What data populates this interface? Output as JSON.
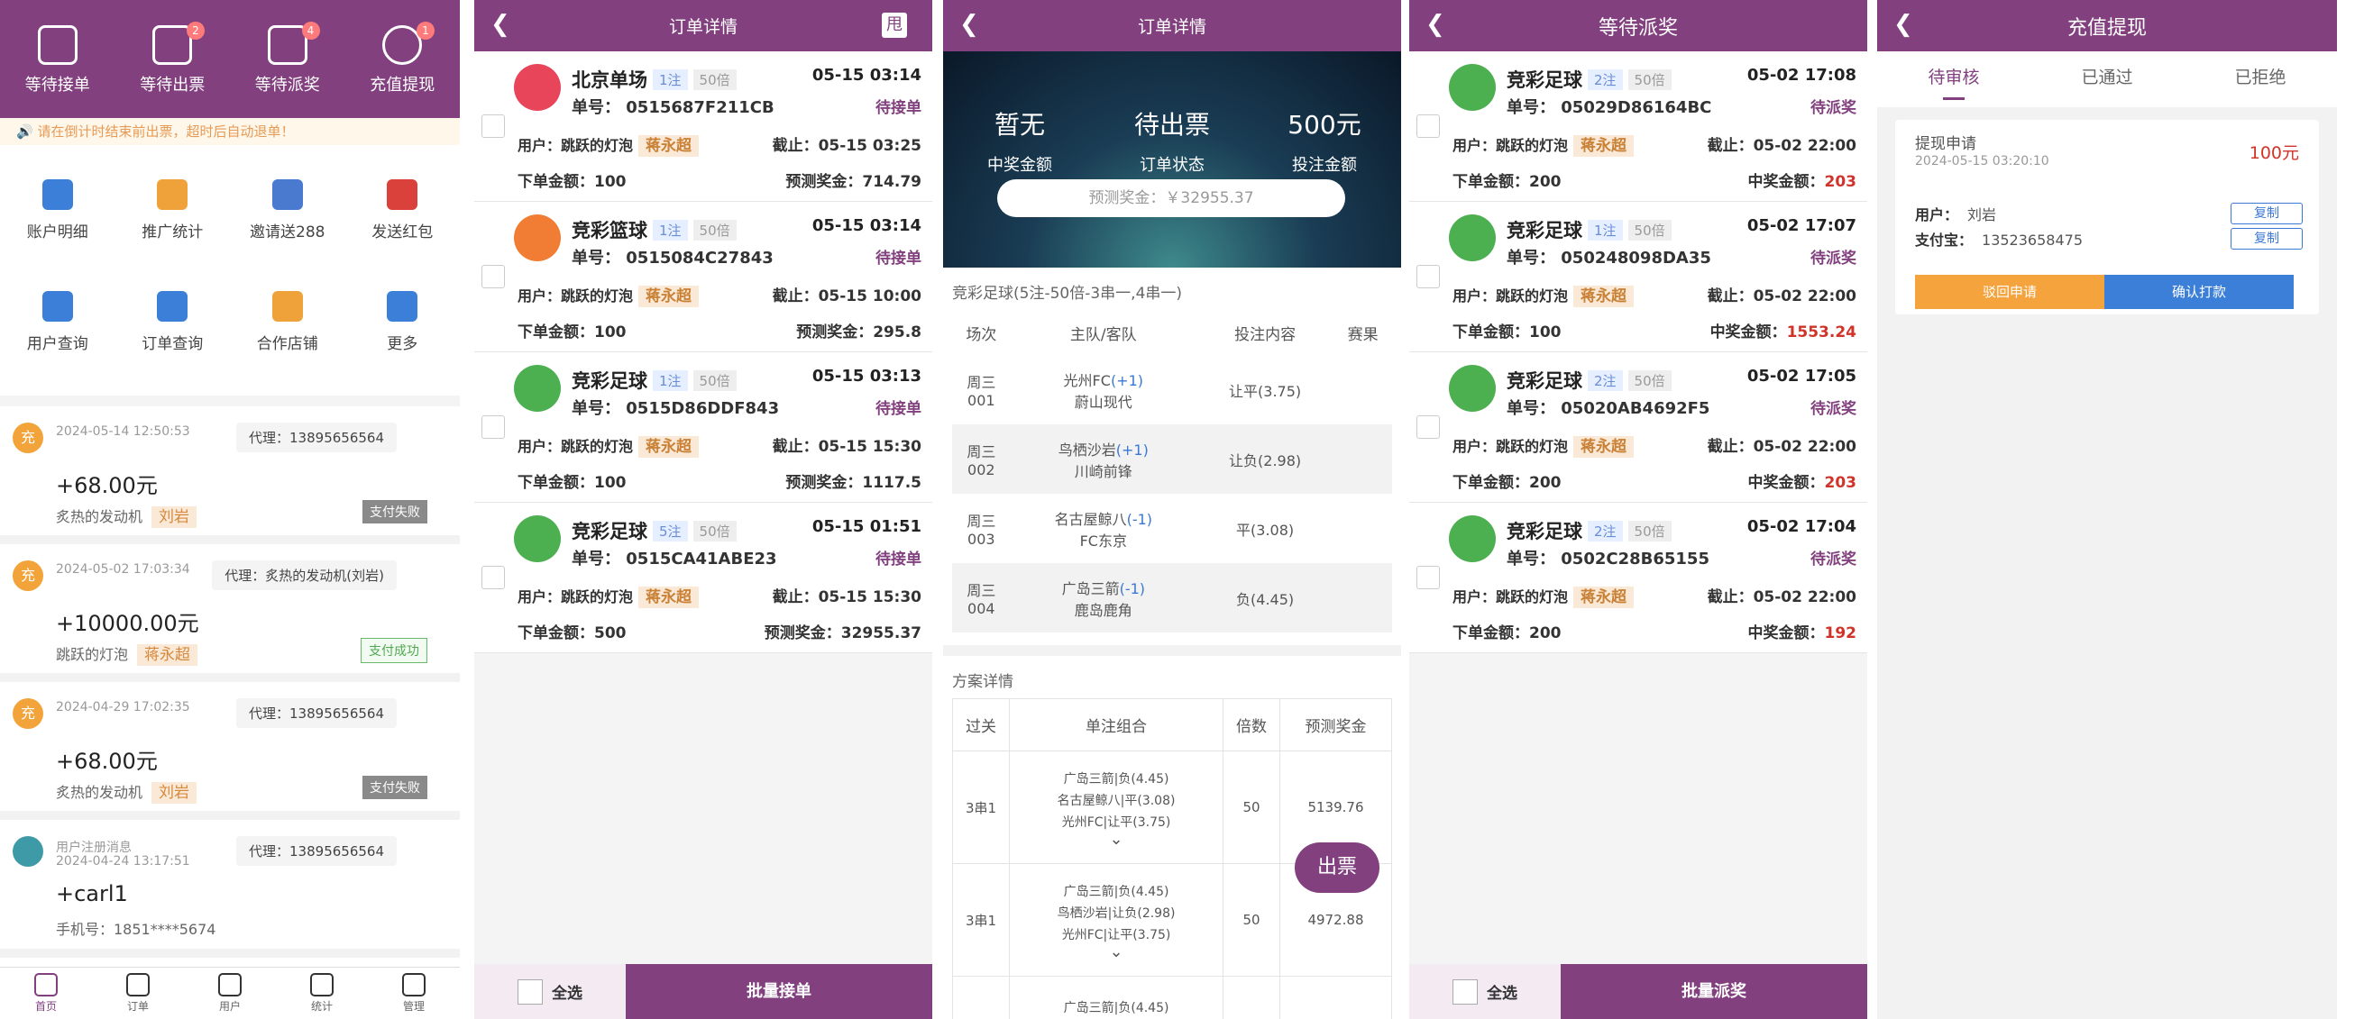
{
  "s1": {
    "top": [
      {
        "label": "等待接单",
        "badge": ""
      },
      {
        "label": "等待出票",
        "badge": "2"
      },
      {
        "label": "等待派奖",
        "badge": "4"
      },
      {
        "label": "充值提现",
        "badge": "1"
      }
    ],
    "notice": "🔊 请在倒计时结束前出票，超时后自动退单！",
    "grid": [
      {
        "label": "账户明细",
        "color": "#3b7fd8"
      },
      {
        "label": "推广统计",
        "color": "#f0a23a"
      },
      {
        "label": "邀请送288",
        "color": "#4a7ad0"
      },
      {
        "label": "发送红包",
        "color": "#d9413a"
      },
      {
        "label": "用户查询",
        "color": "#3b7fd8"
      },
      {
        "label": "订单查询",
        "color": "#3b7fd8"
      },
      {
        "label": "合作店铺",
        "color": "#f0a23a"
      },
      {
        "label": "更多",
        "color": "#3b7fd8"
      }
    ],
    "feed": [
      {
        "av": "充",
        "time": "2024-05-14 12:50:53",
        "agent": "代理：13895656564",
        "amt": "+68.00元",
        "who": "炙热的发动机",
        "tag": "刘岩",
        "status": "支付失败"
      },
      {
        "av": "充",
        "time": "2024-05-02 17:03:34",
        "agent": "代理：炙热的发动机(刘岩)",
        "amt": "+10000.00元",
        "who": "跳跃的灯泡",
        "tag": "蒋永超",
        "status": "支付成功"
      },
      {
        "av": "充",
        "time": "2024-04-29 17:02:35",
        "agent": "代理：13895656564",
        "amt": "+68.00元",
        "who": "炙热的发动机",
        "tag": "刘岩",
        "status": "支付失败"
      },
      {
        "av": "",
        "time": "用户注册消息",
        "time2": "2024-04-24 13:17:51",
        "agent": "代理：13895656564",
        "amt": "+carl1",
        "who": "手机号：1851****5674",
        "tag": "",
        "status": ""
      }
    ],
    "tabbar": [
      "首页",
      "订单",
      "用户",
      "统计",
      "管理"
    ]
  },
  "s2": {
    "title": "订单详情",
    "corner": "甩",
    "orders": [
      {
        "name": "北京单场",
        "bets": "1注",
        "mult": "50倍",
        "date": "05-15 03:14",
        "no": "单号： 0515687F211CB",
        "status": "待接单",
        "user": "用户：跳跃的灯泡",
        "tag": "蒋永超",
        "ddl": "截止：05-15 03:25",
        "money": "下单金额：100",
        "pre": "预测奖金：714.79",
        "logo": "#e8445a"
      },
      {
        "name": "竞彩篮球",
        "bets": "1注",
        "mult": "50倍",
        "date": "05-15 03:14",
        "no": "单号： 0515084C27843",
        "status": "待接单",
        "user": "用户：跳跃的灯泡",
        "tag": "蒋永超",
        "ddl": "截止：05-15 10:00",
        "money": "下单金额：100",
        "pre": "预测奖金：295.8",
        "logo": "#f07d33"
      },
      {
        "name": "竞彩足球",
        "bets": "1注",
        "mult": "50倍",
        "date": "05-15 03:13",
        "no": "单号： 0515D86DDF843",
        "status": "待接单",
        "user": "用户：跳跃的灯泡",
        "tag": "蒋永超",
        "ddl": "截止：05-15 15:30",
        "money": "下单金额：100",
        "pre": "预测奖金：1117.5",
        "logo": "#4caf50"
      },
      {
        "name": "竞彩足球",
        "bets": "5注",
        "mult": "50倍",
        "date": "05-15 01:51",
        "no": "单号： 0515CA41ABE23",
        "status": "待接单",
        "user": "用户：跳跃的灯泡",
        "tag": "蒋永超",
        "ddl": "截止：05-15 15:30",
        "money": "下单金额：500",
        "pre": "预测奖金：32955.37",
        "logo": "#4caf50"
      }
    ],
    "select_all": "全选",
    "action": "批量接单"
  },
  "s3": {
    "title": "订单详情",
    "stats": [
      {
        "big": "暂无",
        "small": "中奖金额"
      },
      {
        "big": "待出票",
        "small": "订单状态"
      },
      {
        "big": "500元",
        "small": "投注金额"
      }
    ],
    "pred": "预测奖金：￥32955.37",
    "section1": "竞彩足球(5注-50倍-3串一,4串一)",
    "headers": [
      "场次",
      "主队/客队",
      "投注内容",
      "赛果"
    ],
    "matches": [
      {
        "d": "周三",
        "n": "001",
        "home": "光州FC(+1)",
        "home_pre": "光州FC",
        "home_hc": "(+1)",
        "away": "蔚山现代",
        "bet": "让平(3.75)"
      },
      {
        "d": "周三",
        "n": "002",
        "home_pre": "鸟栖沙岩",
        "home_hc": "(+1)",
        "away": "川崎前锋",
        "bet": "让负(2.98)"
      },
      {
        "d": "周三",
        "n": "003",
        "home_pre": "名古屋鲸八",
        "home_hc": "(-1)",
        "away": "FC东京",
        "bet": "平(3.08)"
      },
      {
        "d": "周三",
        "n": "004",
        "home_pre": "广岛三箭",
        "home_hc": "(-1)",
        "away": "鹿岛鹿角",
        "bet": "负(4.45)"
      }
    ],
    "section2": "方案详情",
    "plan_headers": [
      "过关",
      "单注组合",
      "倍数",
      "预测奖金"
    ],
    "plans": [
      {
        "pass": "3串1",
        "c1": "广岛三箭|负(4.45)",
        "c2": "名古屋鲸八|平(3.08)",
        "c3": "光州FC|让平(3.75)",
        "mult": "50",
        "prize": "5139.76"
      },
      {
        "pass": "3串1",
        "c1": "广岛三箭|负(4.45)",
        "c2": "鸟栖沙岩|让负(2.98)",
        "c3": "光州FC|让平(3.75)",
        "mult": "50",
        "prize": "4972.88"
      },
      {
        "pass": "",
        "c1": "广岛三箭|负(4.45)",
        "c2": "",
        "c3": "",
        "mult": "",
        "prize": ""
      }
    ],
    "print_btn": "出票"
  },
  "s4": {
    "title": "等待派奖",
    "orders": [
      {
        "name": "竞彩足球",
        "bets": "2注",
        "mult": "50倍",
        "date": "05-02 17:08",
        "no": "单号： 05029D86164BC",
        "status": "待派奖",
        "user": "用户：跳跃的灯泡",
        "tag": "蒋永超",
        "ddl": "截止：05-02 22:00",
        "money": "下单金额：200",
        "pre_label": "中奖金额：",
        "pre": "203"
      },
      {
        "name": "竞彩足球",
        "bets": "1注",
        "mult": "50倍",
        "date": "05-02 17:07",
        "no": "单号： 050248098DA35",
        "status": "待派奖",
        "user": "用户：跳跃的灯泡",
        "tag": "蒋永超",
        "ddl": "截止：05-02 22:00",
        "money": "下单金额：100",
        "pre_label": "中奖金额：",
        "pre": "1553.24"
      },
      {
        "name": "竞彩足球",
        "bets": "2注",
        "mult": "50倍",
        "date": "05-02 17:05",
        "no": "单号： 05020AB4692F5",
        "status": "待派奖",
        "user": "用户：跳跃的灯泡",
        "tag": "蒋永超",
        "ddl": "截止：05-02 22:00",
        "money": "下单金额：200",
        "pre_label": "中奖金额：",
        "pre": "203"
      },
      {
        "name": "竞彩足球",
        "bets": "2注",
        "mult": "50倍",
        "date": "05-02 17:04",
        "no": "单号： 0502C28B65155",
        "status": "待派奖",
        "user": "用户：跳跃的灯泡",
        "tag": "蒋永超",
        "ddl": "截止：05-02 22:00",
        "money": "下单金额：200",
        "pre_label": "中奖金额：",
        "pre": "192"
      }
    ],
    "select_all": "全选",
    "action": "批量派奖"
  },
  "s5": {
    "title": "充值提现",
    "tabs": [
      "待审核",
      "已通过",
      "已拒绝"
    ],
    "card": {
      "l1": "提现申请",
      "l2": "2024-05-15 03:20:10",
      "amt": "100元",
      "user_label": "用户：",
      "user": "刘岩",
      "pay_label": "支付宝：",
      "pay": "13523658475",
      "copy": "复制",
      "reject": "驳回申请",
      "confirm": "确认打款"
    }
  }
}
